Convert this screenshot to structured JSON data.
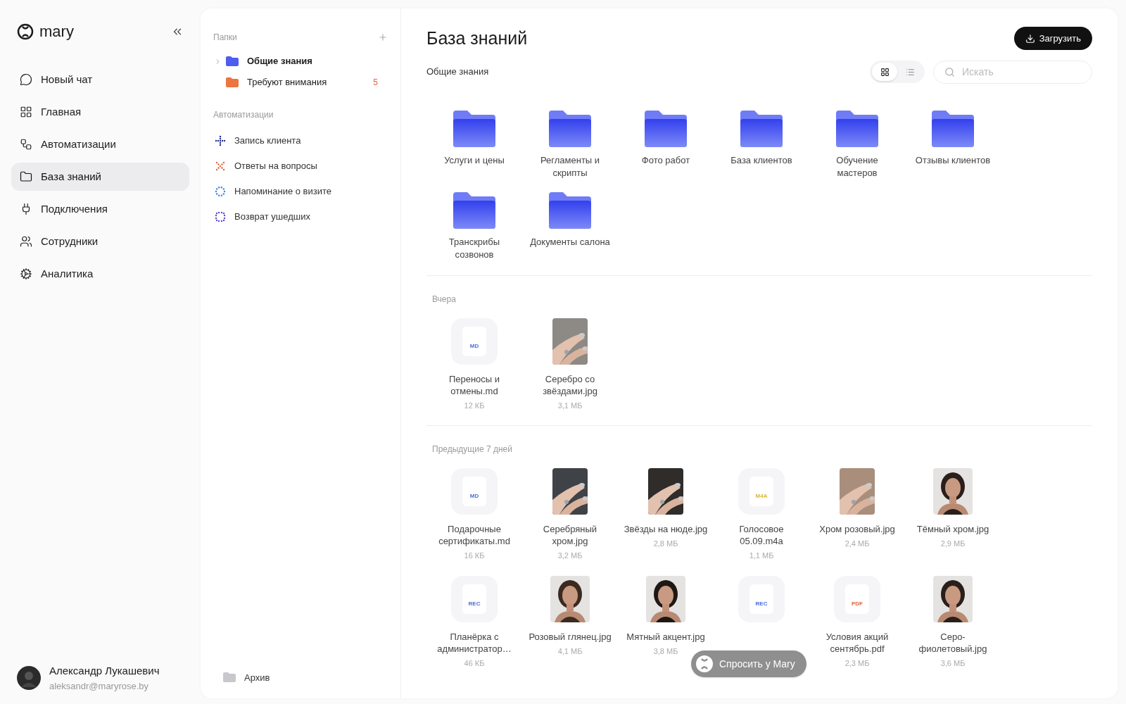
{
  "brand": {
    "name": "mary"
  },
  "nav": [
    {
      "label": "Новый чат",
      "selected": false
    },
    {
      "label": "Главная",
      "selected": false
    },
    {
      "label": "Автоматизации",
      "selected": false
    },
    {
      "label": "База знаний",
      "selected": true
    },
    {
      "label": "Подключения",
      "selected": false
    },
    {
      "label": "Сотрудники",
      "selected": false
    },
    {
      "label": "Аналитика",
      "selected": false
    }
  ],
  "user": {
    "name": "Александр Лукашевич",
    "email": "aleksandr@maryrose.by"
  },
  "folders_panel": {
    "title": "Папки",
    "items": [
      {
        "label": "Общие знания",
        "color": "#4f5cf0",
        "expandable": true,
        "selected": true
      },
      {
        "label": "Требуют внимания",
        "color": "#ee7440",
        "expandable": false,
        "selected": false,
        "count": "5"
      }
    ],
    "automations_title": "Автоматизации",
    "automations": [
      {
        "label": "Запись клиента",
        "color": "#1e2a8c"
      },
      {
        "label": "Ответы на вопросы",
        "color": "#e0653a"
      },
      {
        "label": "Напоминание о визите",
        "color": "#3b82f6"
      },
      {
        "label": "Возврат ушедших",
        "color": "#5b4bd6"
      }
    ],
    "archive": "Архив"
  },
  "main": {
    "title": "База знаний",
    "upload": "Загрузить",
    "breadcrumb": "Общие знания",
    "view_modes": [
      {
        "selected": true
      },
      {
        "selected": false
      }
    ],
    "search": {
      "placeholder": "Искать"
    },
    "folders": [
      "Услуги и цены",
      "Регламенты и скрипты",
      "Фото работ",
      "База клиентов",
      "Обучение мастеров",
      "Отзывы клиентов",
      "Транскрибы созвонов",
      "Документы салона"
    ],
    "sections": [
      {
        "title": "Вчера",
        "items": [
          {
            "kind": "file",
            "ext": "MD",
            "color": "#4a6fd8",
            "name": "Переносы и отмены.md",
            "size": "12 КБ"
          },
          {
            "kind": "picture",
            "name": "Серебро со звёздами.jpg",
            "size": "3,1 МБ"
          }
        ]
      },
      {
        "title": "Предыдущие 7 дней",
        "items": [
          {
            "kind": "file",
            "ext": "MD",
            "color": "#4a6fd8",
            "name": "Подарочные сертификаты.md",
            "size": "16 КБ"
          },
          {
            "kind": "picture",
            "name": "Серебряный хром.jpg",
            "size": "3,2 МБ"
          },
          {
            "kind": "picture",
            "name": "Звёзды на нюде.jpg",
            "size": "2,8 МБ"
          },
          {
            "kind": "file",
            "ext": "M4A",
            "color": "#d9b82e",
            "name": "Голосовое 05.09.m4a",
            "size": "1,1 МБ"
          },
          {
            "kind": "picture",
            "name": "Хром розовый.jpg",
            "size": "2,4 МБ"
          },
          {
            "kind": "portrait",
            "name": "Тёмный хром.jpg",
            "size": "2,9 МБ"
          },
          {
            "kind": "file",
            "ext": "REC",
            "color": "#4a6fd8",
            "name": "Планёрка с администратор…",
            "size": "46 КБ"
          },
          {
            "kind": "portrait",
            "name": "Розовый глянец.jpg",
            "size": "4,1 МБ"
          },
          {
            "kind": "portrait",
            "name": "Мятный акцент.jpg",
            "size": "3,8 МБ"
          },
          {
            "kind": "file",
            "ext": "REC",
            "color": "#4a6fd8"
          },
          {
            "kind": "file",
            "ext": "PDF",
            "color": "#e0653a",
            "name": "Условия акций сентябрь.pdf",
            "size": "2,3 МБ"
          },
          {
            "kind": "portrait",
            "name": "Серо-фиолетовый.jpg",
            "size": "3,6 МБ"
          }
        ]
      }
    ],
    "ask_button": "Спросить у Mary"
  }
}
